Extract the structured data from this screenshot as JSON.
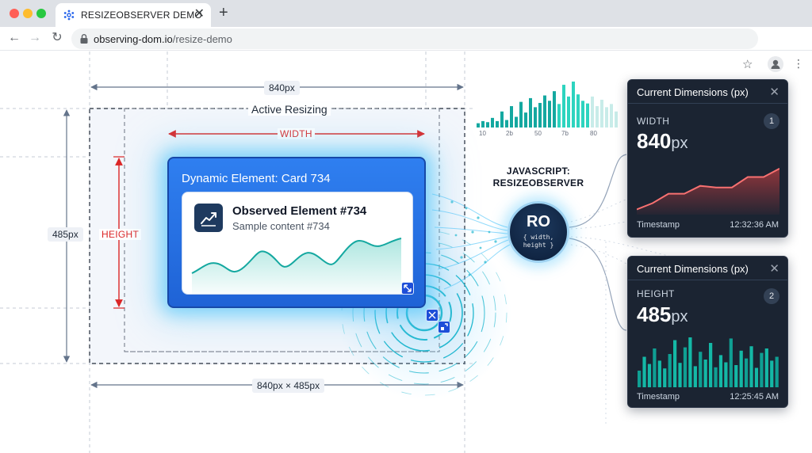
{
  "browser": {
    "tab_title": "RESIZEOBSERVER DEMO",
    "tab_close": "✕",
    "new_tab": "+",
    "url_host": "observing-dom.io",
    "url_path": "/resize-demo",
    "nav_back": "←",
    "nav_forward": "→",
    "nav_reload": "↻",
    "star": "☆",
    "menu": "⋮"
  },
  "diagram": {
    "top_width_label": "840px",
    "active_label": "Active Resizing",
    "width_label": "WIDTH",
    "height_label": "HEIGHT",
    "left_height_label": "485px",
    "bottom_label": "840px × 485px",
    "card_title": "Dynamic Element: Card 734",
    "inner_title": "Observed Element #734",
    "inner_subtitle": "Sample content #734",
    "js_label_line1": "JAVASCRIPT:",
    "js_label_line2": "RESIZEOBSERVER",
    "ro_title": "RO",
    "ro_sub_line1": "{ width,",
    "ro_sub_line2": "height }"
  },
  "mini_chart": {
    "tick_labels": [
      "10",
      "2b",
      "50",
      "7b",
      "80"
    ],
    "values": [
      8,
      12,
      10,
      18,
      12,
      30,
      14,
      40,
      20,
      48,
      28,
      55,
      38,
      46,
      60,
      50,
      68,
      44,
      80,
      58,
      86,
      62,
      50,
      45,
      58,
      40,
      52,
      38,
      44,
      30
    ],
    "colors": [
      "#14a8a0",
      "#2dd4bf",
      "#c8ece9"
    ]
  },
  "panels": [
    {
      "title": "Current Dimensions (px)",
      "close": "✕",
      "label": "WIDTH",
      "value": "840",
      "unit": "px",
      "badge": "1",
      "footer_label": "Timestamp",
      "footer_time": "12:32:36 AM",
      "line_values": [
        10,
        22,
        40,
        40,
        55,
        52,
        52,
        72,
        72,
        88
      ]
    },
    {
      "title": "Current Dimensions (px)",
      "close": "✕",
      "label": "HEIGHT",
      "value": "485",
      "unit": "px",
      "badge": "2",
      "footer_label": "Timestamp",
      "footer_time": "12:25:45 AM",
      "bar_values": [
        30,
        55,
        42,
        70,
        48,
        34,
        60,
        85,
        44,
        72,
        90,
        38,
        64,
        50,
        80,
        36,
        58,
        45,
        88,
        40,
        66,
        52,
        74,
        35,
        62,
        70,
        48,
        55
      ]
    }
  ],
  "colors": {
    "accent": "#2f7ff0",
    "teal": "#14a8a0",
    "red_dimension": "#dc2626",
    "panel_bg": "#1b2432"
  }
}
